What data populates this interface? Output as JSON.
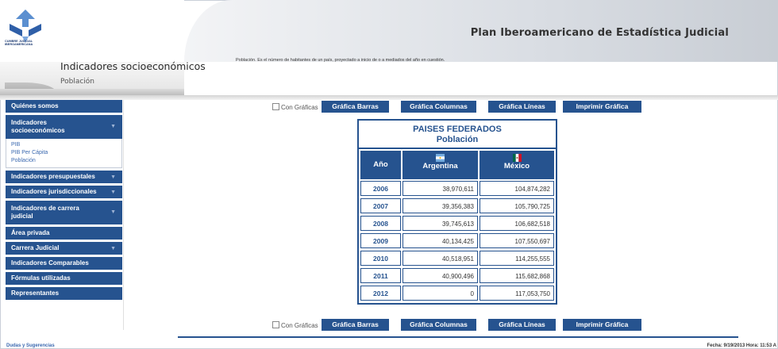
{
  "header": {
    "title": "Plan Iberoamericano de Estadística Judicial",
    "logo_text": "CUMBRE JUDICIAL IBEROAMERICANA"
  },
  "subheader": {
    "title": "Indicadores socioeconómicos",
    "subtitle": "Población",
    "definition": "Población. Es el número de habitantes de un país, proyectado a inicio de o a mediados del año en cuestión."
  },
  "sidebar": {
    "items": [
      {
        "label": "Quiénes somos"
      },
      {
        "label": "Indicadores socioeconómicos",
        "sub": [
          "PIB",
          "PIB Per Cápita",
          "Población"
        ]
      },
      {
        "label": "Indicadores presupuestales"
      },
      {
        "label": "Indicadores jurisdiccionales"
      },
      {
        "label": "Indicadores de carrera judicial"
      },
      {
        "label": "Área privada"
      },
      {
        "label": "Carrera Judicial"
      },
      {
        "label": "Indicadores Comparables"
      },
      {
        "label": "Fórmulas utilizadas"
      },
      {
        "label": "Representantes"
      }
    ]
  },
  "toolbar": {
    "checkbox_label": "Con Gráficas",
    "buttons": [
      "Gráfica Barras",
      "Gráfica Columnas",
      "Gráfica Líneas",
      "Imprimir Gráfica"
    ]
  },
  "table": {
    "title": "PAISES FEDERADOS",
    "subtitle": "Población",
    "col_year": "Año",
    "countries": [
      "Argentina",
      "México"
    ],
    "rows": [
      {
        "year": "2006",
        "argentina": "38,970,611",
        "mexico": "104,874,282"
      },
      {
        "year": "2007",
        "argentina": "39,356,383",
        "mexico": "105,790,725"
      },
      {
        "year": "2008",
        "argentina": "39,745,613",
        "mexico": "106,682,518"
      },
      {
        "year": "2009",
        "argentina": "40,134,425",
        "mexico": "107,550,697"
      },
      {
        "year": "2010",
        "argentina": "40,518,951",
        "mexico": "114,255,555"
      },
      {
        "year": "2011",
        "argentina": "40,900,496",
        "mexico": "115,682,868"
      },
      {
        "year": "2012",
        "argentina": "0",
        "mexico": "117,053,750"
      }
    ]
  },
  "footer": {
    "link": "Dudas y Sugerencias",
    "datetime": "Fecha: 9/19/2013 Hora: 11:53 A"
  },
  "colors": {
    "primary": "#26538f",
    "link": "#3b69b0"
  }
}
